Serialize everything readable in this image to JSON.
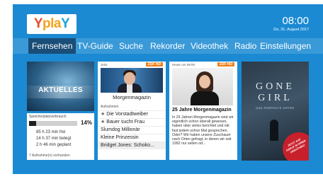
{
  "header": {
    "logo": [
      "Y",
      "pla",
      "Y",
      ""
    ],
    "time": "08:00",
    "date": "Do, 31. August 2017"
  },
  "nav": {
    "items": [
      "Fernsehen",
      "TV-Guide",
      "Suche",
      "Rekorder",
      "Videothek",
      "Radio",
      "Einstellungen"
    ],
    "active": "Fernsehen"
  },
  "tiles": {
    "aktuelles": {
      "label": "AKTUELLES"
    },
    "storage": {
      "title": "Speicherplatzverbrauch",
      "percent": "14%",
      "percent_value": 0.14,
      "lines": [
        "85 h 23 min frei",
        "14 h 37 min belegt",
        "2 h 46 min geplant"
      ],
      "footer": "7 Aufnahme(n) vorhanden"
    },
    "now": {
      "header": "Jetzt",
      "channel": "ZDF HD",
      "caption": "Morgenmagazin"
    },
    "recordings": {
      "header": "Aufnahmen",
      "items": [
        {
          "title": "Die Vorstadtweiber",
          "starred": true
        },
        {
          "title": "Bauer sucht Frau",
          "starred": true
        },
        {
          "title": "Slumdog Millionär",
          "starred": false
        },
        {
          "title": "Kleine Prinzessin",
          "starred": false
        },
        {
          "title": "Bridget Jones: Schoko...",
          "starred": false
        }
      ]
    },
    "article": {
      "header": "Heute um 09:00",
      "channel": "ZDF HD",
      "title": "25 Jahre Morgenmagazin",
      "body": "In 25 Jahren Morgenmagazin sind wir eigentlich schon überall gewesen, haben über vieles berichtet und mit fast jedem schon Mal gesprochen. Oder? Wir haben unsere Zuschauer nach Orten gefragt, in denen wir seit 1992 nur selten od..."
    },
    "movie": {
      "title_line1": "GONE",
      "title_line2": "GIRL",
      "subtitle": "DAS PERFEKTE OPFER",
      "seal": "JETZT AUF ABRUF IN IHRER VIDEOTHEK!"
    }
  },
  "colors": {
    "background": "#1b8ad3",
    "nav_bar": "#3a9ad8",
    "nav_active": "#1a4d77",
    "zdf_orange": "#f07f1c",
    "seal_red": "#c8202b"
  }
}
